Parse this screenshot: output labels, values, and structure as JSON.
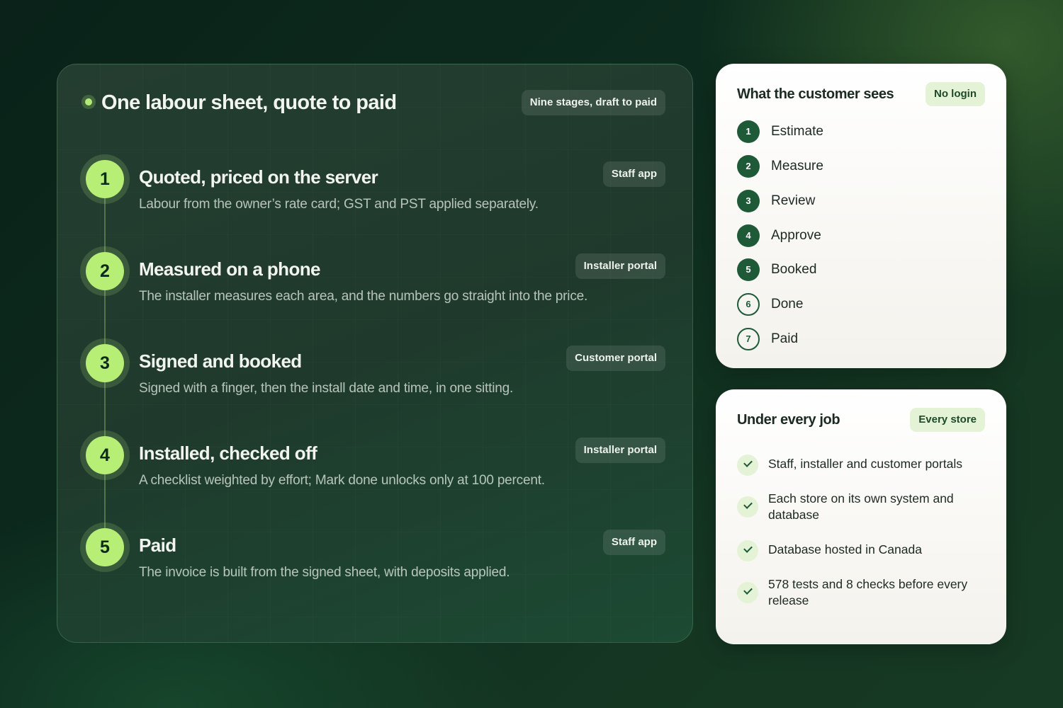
{
  "flow": {
    "title": "One labour sheet, quote to paid",
    "badge": "Nine stages, draft to paid",
    "steps": [
      {
        "number": "1",
        "title": "Quoted, priced on the server",
        "description": "Labour from the owner’s rate card; GST and PST applied separately.",
        "tag": "Staff app"
      },
      {
        "number": "2",
        "title": "Measured on a phone",
        "description": "The installer measures each area, and the numbers go straight into the price.",
        "tag": "Installer portal"
      },
      {
        "number": "3",
        "title": "Signed and booked",
        "description": "Signed with a finger, then the install date and time, in one sitting.",
        "tag": "Customer portal"
      },
      {
        "number": "4",
        "title": "Installed, checked off",
        "description": "A checklist weighted by effort; Mark done unlocks only at 100 percent.",
        "tag": "Installer portal"
      },
      {
        "number": "5",
        "title": "Paid",
        "description": "The invoice is built from the signed sheet, with deposits applied.",
        "tag": "Staff app"
      }
    ]
  },
  "customer_view": {
    "title": "What the customer sees",
    "badge": "No login",
    "steps": [
      {
        "number": "1",
        "label": "Estimate",
        "state": "filled"
      },
      {
        "number": "2",
        "label": "Measure",
        "state": "filled"
      },
      {
        "number": "3",
        "label": "Review",
        "state": "filled"
      },
      {
        "number": "4",
        "label": "Approve",
        "state": "filled"
      },
      {
        "number": "5",
        "label": "Booked",
        "state": "filled"
      },
      {
        "number": "6",
        "label": "Done",
        "state": "outline"
      },
      {
        "number": "7",
        "label": "Paid",
        "state": "outline"
      }
    ]
  },
  "foundation": {
    "title": "Under every job",
    "badge": "Every store",
    "items": [
      "Staff, installer and customer portals",
      "Each store on its own system and database",
      "Database hosted in Canada",
      "578 tests and 8 checks before every release"
    ]
  },
  "colors": {
    "accent_lime": "#b6ee76",
    "dark_green": "#1e5a37",
    "badge_light": "#e4f3d6"
  }
}
